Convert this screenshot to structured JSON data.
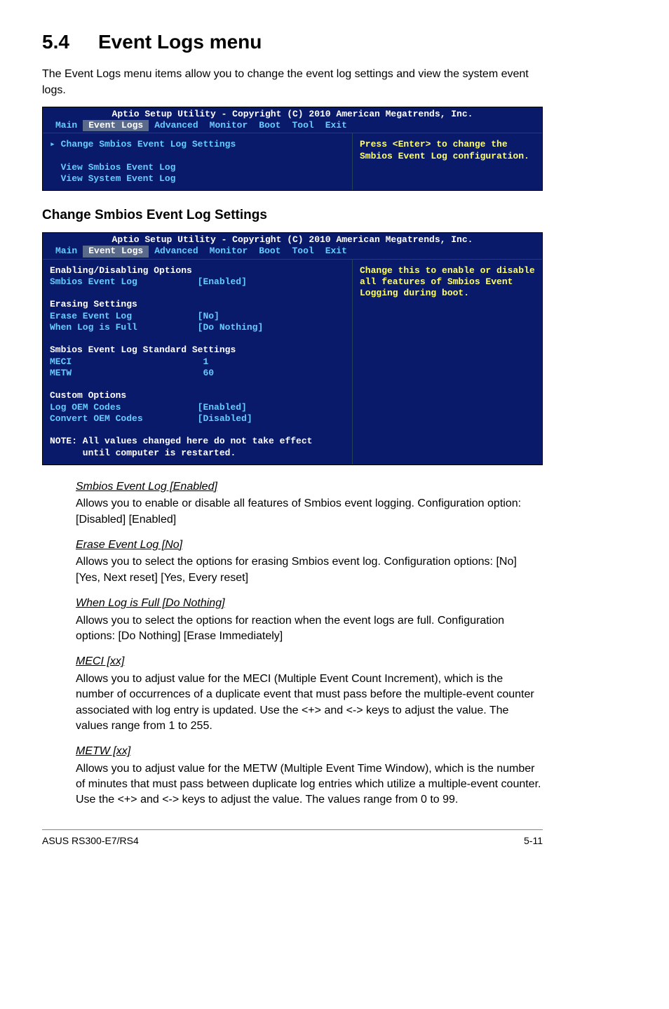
{
  "heading_num": "5.4",
  "heading_title": "Event Logs menu",
  "intro": "The Event Logs menu items allow you to change the event log settings and view the system event logs.",
  "bios1": {
    "title": "Aptio Setup Utility - Copyright (C) 2010 American Megatrends, Inc.",
    "tabs": [
      "Main",
      "Event Logs",
      "Advanced",
      "Monitor",
      "Boot",
      "Tool",
      "Exit"
    ],
    "item1": "Change Smbios Event Log Settings",
    "item2": "View Smbios Event Log",
    "item3": "View System Event Log",
    "help": "Press <Enter> to change the Smbios Event Log configuration."
  },
  "subheading": "Change Smbios Event Log Settings",
  "bios2": {
    "title": "Aptio Setup Utility - Copyright (C) 2010 American Megatrends, Inc.",
    "tabs": [
      "Main",
      "Event Logs",
      "Advanced",
      "Monitor",
      "Boot",
      "Tool",
      "Exit"
    ],
    "sec1_head": "Enabling/Disabling Options",
    "sec1_item1_label": "Smbios Event Log",
    "sec1_item1_val": "[Enabled]",
    "sec2_head": "Erasing Settings",
    "sec2_item1_label": "Erase Event Log",
    "sec2_item1_val": "[No]",
    "sec2_item2_label": "When Log is Full",
    "sec2_item2_val": "[Do Nothing]",
    "sec3_head": "Smbios Event Log Standard Settings",
    "sec3_item1_label": "MECI",
    "sec3_item1_val": "1",
    "sec3_item2_label": "METW",
    "sec3_item2_val": "60",
    "sec4_head": "Custom Options",
    "sec4_item1_label": "Log OEM Codes",
    "sec4_item1_val": "[Enabled]",
    "sec4_item2_label": "Convert OEM Codes",
    "sec4_item2_val": "[Disabled]",
    "note": "NOTE: All values changed here do not take effect\n      until computer is restarted.",
    "help": "Change this to enable or disable all features of Smbios Event Logging during boot."
  },
  "descs": [
    {
      "title": "Smbios Event Log [Enabled]",
      "text": "Allows you to enable or disable all features of Smbios event logging. Configuration option: [Disabled] [Enabled]"
    },
    {
      "title": "Erase Event Log [No]",
      "text": "Allows you to select the options for erasing Smbios event log. Configuration options: [No] [Yes, Next reset] [Yes, Every reset]"
    },
    {
      "title": "When Log is Full [Do Nothing]",
      "text": "Allows you to select the options for reaction when the event logs are full. Configuration options: [Do Nothing] [Erase Immediately]"
    },
    {
      "title": "MECI [xx]",
      "text": "Allows you to adjust value for the MECI (Multiple Event Count Increment), which is the number of occurrences of a duplicate event that must pass before the multiple-event counter associated with log entry is updated. Use the <+> and <-> keys to adjust the value. The values range from 1 to 255."
    },
    {
      "title": "METW [xx]",
      "text": "Allows you to adjust value for the METW (Multiple Event Time Window), which is the number of minutes that must pass between duplicate log entries which utilize a multiple-event counter. Use the <+> and <-> keys to adjust the value. The values range from 0 to 99."
    }
  ],
  "footer_left": "ASUS RS300-E7/RS4",
  "footer_right": "5-11"
}
